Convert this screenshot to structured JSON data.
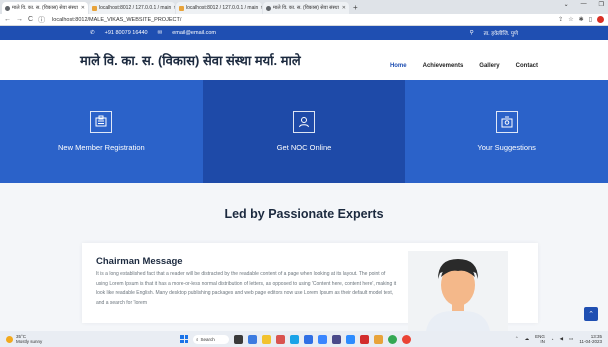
{
  "browser": {
    "tabs": [
      {
        "title": "माले वि. का. स. (विकास) सेवा संस्था",
        "active": true
      },
      {
        "title": "localhost:8012 / 127.0.0.1 / main",
        "active": false
      },
      {
        "title": "localhost:8012 / 127.0.0.1 / main",
        "active": false
      },
      {
        "title": "माले वि. का. स. (विकास) सेवा संस्था",
        "active": false
      }
    ],
    "new_tab": "+",
    "url": "localhost:8012/MALE_VIKAS_WEBSITE_PROJECT/",
    "back": "←",
    "forward": "→",
    "reload": "C"
  },
  "topbar": {
    "phone": "+91 80079 16440",
    "email": "email@email.com",
    "location": "ता. हवेलीजि. पुणे"
  },
  "header": {
    "site_title": "माले वि. का. स. (विकास) सेवा संस्था मर्या. माले",
    "nav": [
      {
        "label": "Home",
        "active": true
      },
      {
        "label": "Achievements",
        "active": false
      },
      {
        "label": "Gallery",
        "active": false
      },
      {
        "label": "Contact",
        "active": false
      }
    ]
  },
  "services": [
    {
      "label": "New Member Registration",
      "icon": "register-icon"
    },
    {
      "label": "Get NOC Online",
      "icon": "user-doc-icon"
    },
    {
      "label": "Your Suggestions",
      "icon": "suggestion-icon"
    }
  ],
  "experts": {
    "heading": "Led by Passionate Experts",
    "chairman": {
      "title": "Chairman Message",
      "text": "It is a long established fact that a reader will be distracted by the readable content of a page when looking at its layout. The point of using Lorem Ipsum is that it has a more-or-less normal distribution of letters, as opposed to using 'Content here, content here', making it look like readable English. Many desktop publishing packages and web page editors now use Lorem Ipsum as their default model text, and a search for 'lorem"
    }
  },
  "taskbar": {
    "temperature": "35°C",
    "weather": "Mostly sunny",
    "search": "Search",
    "lang": "ENG",
    "region": "IN",
    "time": "13:35",
    "date": "11-04-2023"
  },
  "colors": {
    "primary": "#1f4fb2",
    "service_light": "#2b62c9",
    "service_dark": "#1e4aa8"
  }
}
